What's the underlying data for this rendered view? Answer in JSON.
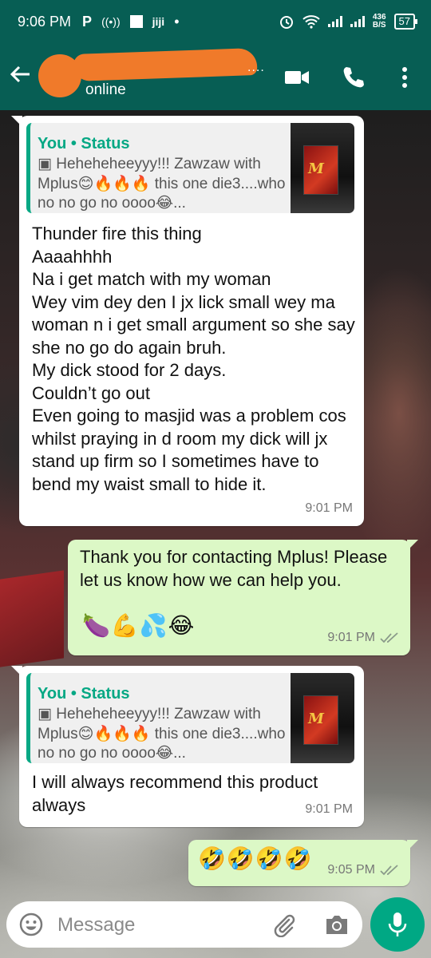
{
  "status_bar": {
    "time": "9:06 PM",
    "app_icon": "P",
    "network_speed": "436\nB/S",
    "battery": "57"
  },
  "header": {
    "status": "online",
    "name_dots": "....",
    "icons": [
      "back-arrow-icon",
      "video-call-icon",
      "phone-icon",
      "more-vert-icon"
    ]
  },
  "messages": [
    {
      "direction": "incoming",
      "quote": {
        "author": "You • Status",
        "text": "▣ Heheheheeyyy!!! Zawzaw with Mplus😊🔥🔥🔥 this one die3....who no no go no oooo😂..."
      },
      "text": "Thunder fire this thing\nAaaahhhh\nNa i get match with my woman\nWey vim dey den I jx lick small wey ma woman n i get small argument so she say she no go do again bruh.\nMy dick stood for 2 days.\nCouldn’t go out\nEven going to masjid was a problem cos whilst praying in d room my dick will jx stand up firm so I sometimes have to bend my waist small to hide it.",
      "time": "9:01 PM"
    },
    {
      "direction": "outgoing",
      "text": "Thank you for contacting Mplus! Please let us know how we can help you.",
      "emojis": "🍆💪💦😂",
      "time": "9:01 PM"
    },
    {
      "direction": "incoming",
      "quote": {
        "author": "You • Status",
        "text": "▣ Heheheheeyyy!!! Zawzaw with Mplus😊🔥🔥🔥 this one die3....who no no go no oooo😂..."
      },
      "text": "I will always recommend this product always",
      "time": "9:01 PM"
    },
    {
      "direction": "outgoing",
      "emojis": "🤣🤣🤣🤣",
      "time": "9:05 PM"
    }
  ],
  "composer": {
    "placeholder": "Message"
  },
  "colors": {
    "header": "#075e54",
    "accent": "#00a884",
    "outgoing_bubble": "#dcf8c6",
    "incoming_bubble": "#ffffff"
  }
}
